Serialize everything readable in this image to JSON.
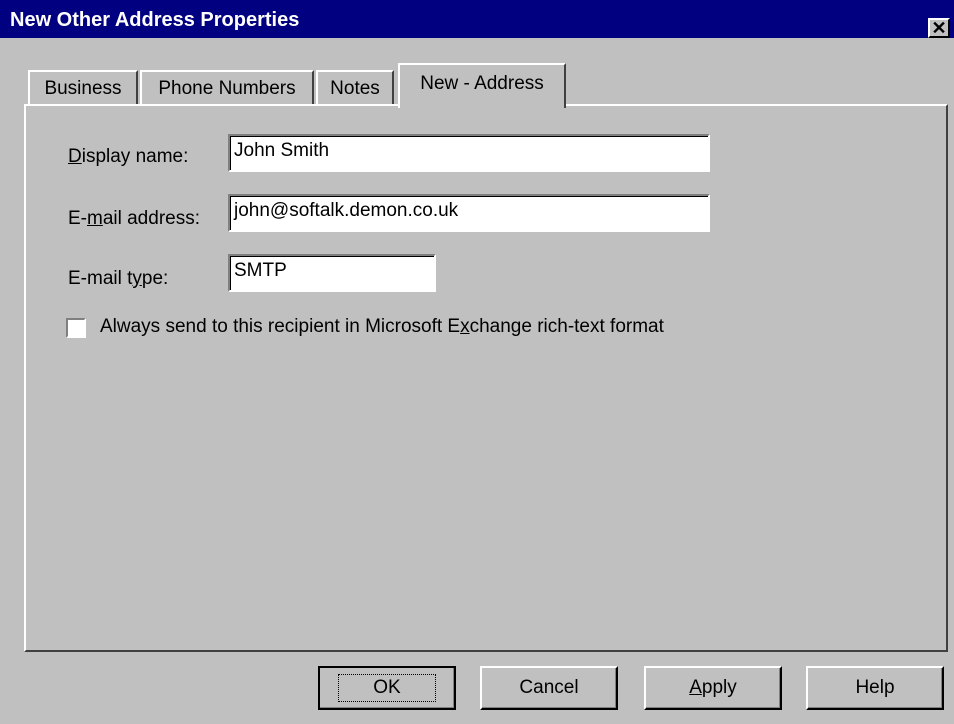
{
  "window": {
    "title": "New Other Address Properties",
    "close_glyph": "✕"
  },
  "tabs": [
    {
      "label": "Business"
    },
    {
      "label": "Phone Numbers"
    },
    {
      "label": "Notes"
    },
    {
      "label": "New - Address"
    }
  ],
  "form": {
    "display_name": {
      "label_prefix": "",
      "label_key": "D",
      "label_rest": "isplay name:",
      "value": "John Smith"
    },
    "email_address": {
      "label_prefix": "E-",
      "label_key": "m",
      "label_rest": "ail address:",
      "value": "john@softalk.demon.co.uk"
    },
    "email_type": {
      "label_prefix": "E-mail t",
      "label_key": "y",
      "label_rest": "pe:",
      "value": "SMTP"
    },
    "rich_text": {
      "label_prefix": "Always send to this recipient in Microsoft E",
      "label_key": "x",
      "label_rest": "change rich-text format",
      "checked": false
    }
  },
  "buttons": {
    "ok": "OK",
    "cancel": "Cancel",
    "apply_key": "A",
    "apply_rest": "pply",
    "help": "Help"
  }
}
